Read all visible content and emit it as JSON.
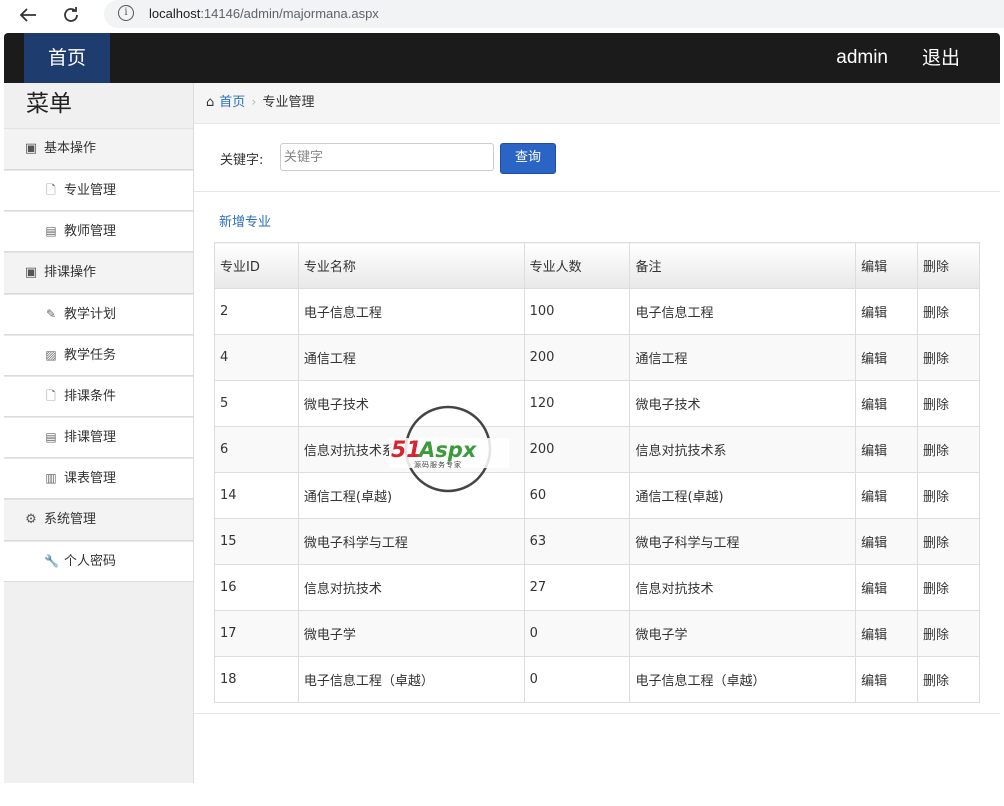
{
  "browser": {
    "url_host": "localhost",
    "url_rest": ":14146/admin/majormana.aspx"
  },
  "header": {
    "home": "首页",
    "user": "admin",
    "logout": "退出"
  },
  "sidebar": {
    "title": "菜单",
    "groups": [
      {
        "label": "基本操作",
        "icon": "user-card-icon",
        "items": [
          {
            "label": "专业管理",
            "icon": "file-icon"
          },
          {
            "label": "教师管理",
            "icon": "list-icon"
          }
        ]
      },
      {
        "label": "排课操作",
        "icon": "user-card-icon",
        "items": [
          {
            "label": "教学计划",
            "icon": "plug-icon"
          },
          {
            "label": "教学任务",
            "icon": "picture-icon"
          },
          {
            "label": "排课条件",
            "icon": "file-icon"
          },
          {
            "label": "排课管理",
            "icon": "list-icon"
          },
          {
            "label": "课表管理",
            "icon": "books-icon"
          }
        ]
      },
      {
        "label": "系统管理",
        "icon": "gear-icon",
        "items": [
          {
            "label": "个人密码",
            "icon": "wrench-icon"
          }
        ]
      }
    ]
  },
  "breadcrumb": {
    "home": "首页",
    "current": "专业管理"
  },
  "search": {
    "label": "关键字:",
    "placeholder": "关键字",
    "button": "查询"
  },
  "actions": {
    "add": "新增专业"
  },
  "table": {
    "headers": [
      "专业ID",
      "专业名称",
      "专业人数",
      "备注",
      "编辑",
      "删除"
    ],
    "rows": [
      [
        "2",
        "电子信息工程",
        "100",
        "电子信息工程",
        "编辑",
        "删除"
      ],
      [
        "4",
        "通信工程",
        "200",
        "通信工程",
        "编辑",
        "删除"
      ],
      [
        "5",
        "微电子技术",
        "120",
        "微电子技术",
        "编辑",
        "删除"
      ],
      [
        "6",
        "信息对抗技术系",
        "200",
        "信息对抗技术系",
        "编辑",
        "删除"
      ],
      [
        "14",
        "通信工程(卓越)",
        "60",
        "通信工程(卓越)",
        "编辑",
        "删除"
      ],
      [
        "15",
        "微电子科学与工程",
        "63",
        "微电子科学与工程",
        "编辑",
        "删除"
      ],
      [
        "16",
        "信息对抗技术",
        "27",
        "信息对抗技术",
        "编辑",
        "删除"
      ],
      [
        "17",
        "微电子学",
        "0",
        "微电子学",
        "编辑",
        "删除"
      ],
      [
        "18",
        "电子信息工程（卓越）",
        "0",
        "电子信息工程（卓越）",
        "编辑",
        "删除"
      ]
    ]
  },
  "watermark": {
    "brand_red": "51",
    "brand_rest": "Aspx",
    "tagline": "源码服务专家"
  },
  "colors": {
    "header_bg": "#1b1b1b",
    "brand_bg": "#1e3d6e",
    "link": "#2a6ebb",
    "button": "#2a64c4",
    "watermark_red": "#d9232e",
    "watermark_green": "#3c9a3c"
  }
}
